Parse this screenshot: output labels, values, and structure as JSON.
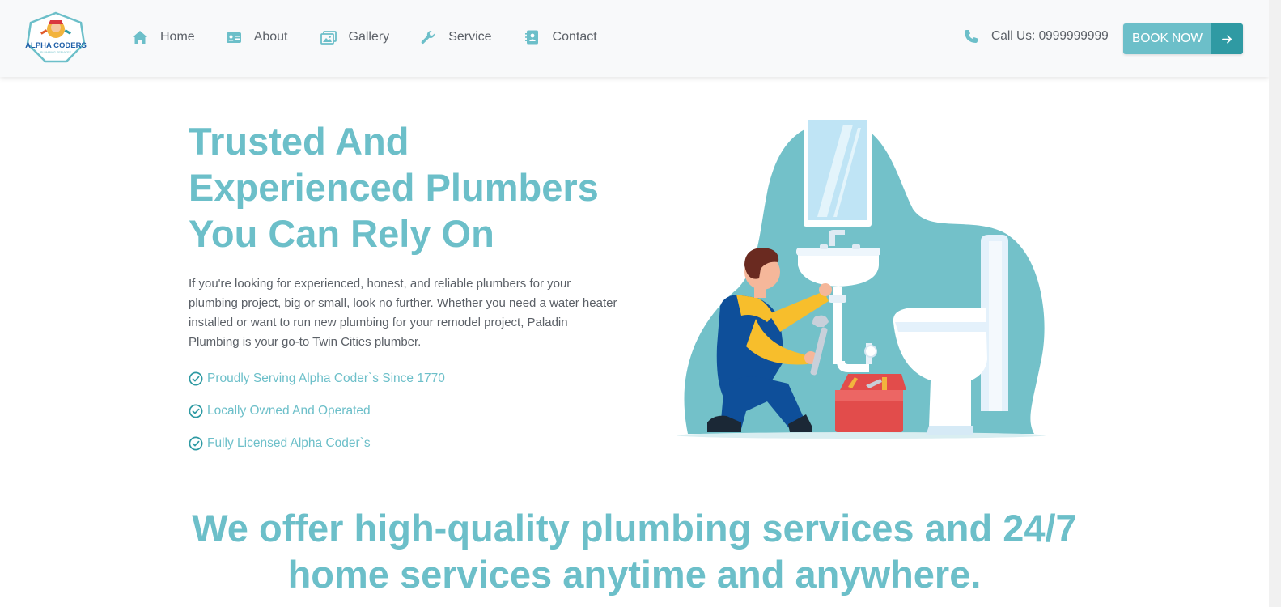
{
  "brand": {
    "name": "ALPHA CODERS",
    "tagline": "PLUMBING SERVICES"
  },
  "nav": {
    "items": [
      {
        "label": "Home",
        "icon": "home-icon"
      },
      {
        "label": "About",
        "icon": "id-card-icon"
      },
      {
        "label": "Gallery",
        "icon": "image-icon"
      },
      {
        "label": "Service",
        "icon": "wrench-icon"
      },
      {
        "label": "Contact",
        "icon": "contact-card-icon"
      }
    ]
  },
  "header": {
    "call_label": "Call Us: 0999999999",
    "call_icon": "phone-icon",
    "book_label": "BOOK NOW",
    "book_icon": "arrow-right-icon"
  },
  "hero": {
    "title": "Trusted And Experienced Plumbers You Can Rely On",
    "description": "If you're looking for experienced, honest, and reliable plumbers for your plumbing project, big or small, look no further. Whether you need a water heater installed or want to run new plumbing for your remodel project, Paladin Plumbing is your go-to Twin Cities plumber.",
    "features": [
      "Proudly Serving Alpha Coder`s Since 1770",
      "Locally Owned And Operated",
      "Fully Licensed Alpha Coder`s"
    ],
    "feature_icon": "check-circle-icon",
    "illustration": "plumber-fixing-sink-illustration"
  },
  "services_heading": "We offer high-quality plumbing services and 24/7 home services anytime and anywhere.",
  "colors": {
    "accent": "#6cbfc9",
    "accent_dark": "#2f9aa3",
    "header_bg": "#f8f9fa",
    "text": "#5b6067"
  }
}
